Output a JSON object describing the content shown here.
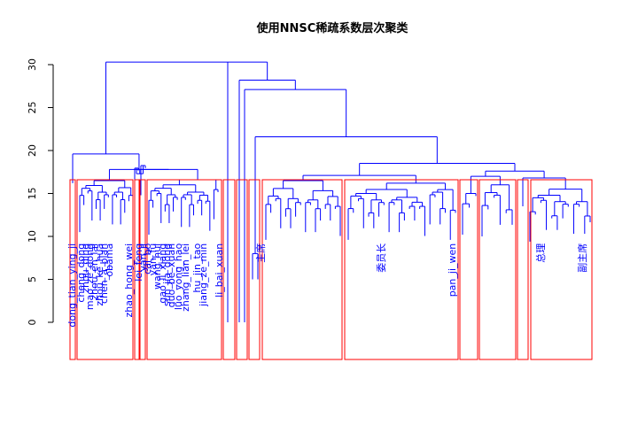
{
  "chart_data": {
    "type": "dendrogram",
    "title": "使用NNSC稀疏系数层次聚类",
    "xlabel": "",
    "ylabel": "",
    "ylim": [
      -4,
      31
    ],
    "y_ticks": [
      0,
      5,
      10,
      15,
      20,
      25,
      30
    ],
    "y_tick_labels": [
      "0",
      "5",
      "10",
      "15",
      "20",
      "25",
      "30"
    ],
    "colors": {
      "branches": "#0000ff",
      "leaf_labels": "#0000ff",
      "cluster_boxes": "#ff0000",
      "text": "#000000"
    },
    "merge_heights": {
      "root": 30.3,
      "right_group": 28.2,
      "inner_group": 27.1,
      "large_group": 21.6,
      "left_group": 19.6,
      "left_inner": 17.8,
      "right_inner": 18.5
    },
    "leaf_labels": [
      "dong_tian_ying_ji",
      "cheng_dong",
      "zhou_ding",
      "mao_ze_dong",
      "zhou_en_lai",
      "zhou_ke_hua",
      "chen_a_bian",
      "obama",
      "zhao_hong_wei",
      "lei_feng",
      "yan_ji",
      "cai_bo",
      "yan_fu",
      "wang_hui",
      "gao_li_xiang",
      "sun_jia_dong",
      "guo_be_xuan",
      "luo_yong_hao",
      "zhang_lian_lei",
      "hu_jin_tao",
      "jiang_ze_min",
      "li_bai_xuan",
      "主席",
      "委员长",
      "pan_ji_wen",
      "总理",
      "副主席"
    ],
    "clusters": 12
  }
}
